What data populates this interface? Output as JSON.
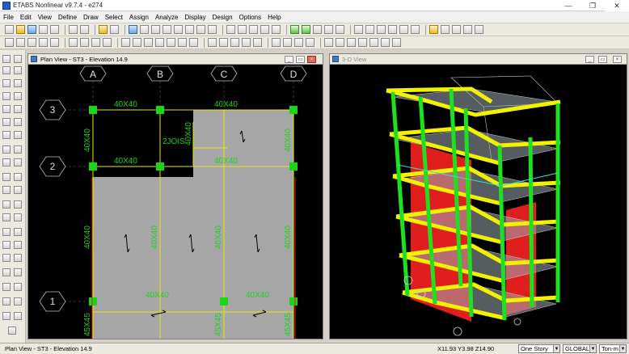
{
  "app": {
    "title": "ETABS Nonlinear v9.7.4 - e274"
  },
  "window_controls": {
    "minimize": "—",
    "maximize": "❐",
    "close": "✕"
  },
  "menu": [
    "File",
    "Edit",
    "View",
    "Define",
    "Draw",
    "Select",
    "Assign",
    "Analyze",
    "Display",
    "Design",
    "Options",
    "Help"
  ],
  "plan_view": {
    "title": "Plan View - ST3 - Elevation 14.9",
    "grid_x": [
      "A",
      "B",
      "C",
      "D"
    ],
    "grid_y": [
      "3",
      "2",
      "1"
    ],
    "labels": {
      "top_a": "40X40",
      "top_b": "40X40",
      "mid_a": "40X40",
      "mid_b": "40X40",
      "bot_a": "40X40",
      "bot_b": "40X40",
      "col_3_a": "40X40",
      "col_3_d": "40X40",
      "col_2_a": "40X40",
      "col_2_b": "40X40",
      "col_2_c": "40X40",
      "col_2_d": "40X40",
      "col_1_a": "45X45",
      "col_1_c": "45X45",
      "col_1_d": "45X45",
      "joist": "2JOIS",
      "joist_v": "40X40"
    }
  },
  "view_3d": {
    "title": "3-D View"
  },
  "status": {
    "left": "Plan View - ST3 - Elevation 14.9",
    "coords": "X11.93  Y3.98  Z14.90",
    "story_select": "One Story",
    "coord_system": "GLOBAL",
    "units": "Ton-m"
  }
}
